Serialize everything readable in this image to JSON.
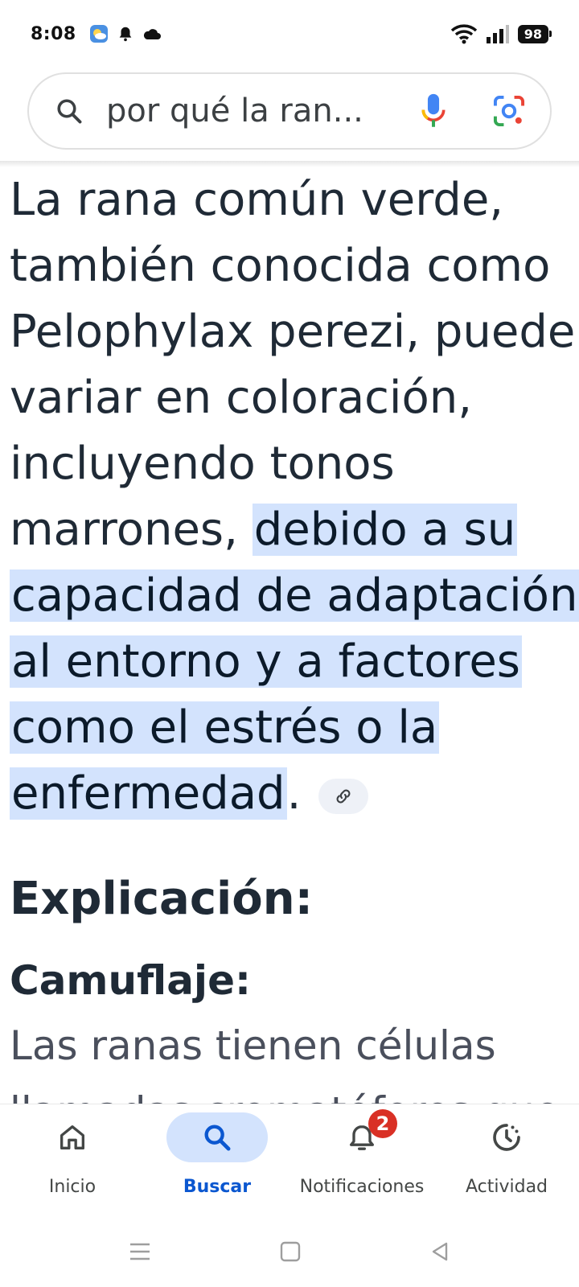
{
  "status_bar": {
    "time": "8:08",
    "battery": "98"
  },
  "search": {
    "query": "por qué la ran..."
  },
  "answer": {
    "line1": "La rana común verde,",
    "line2": "también conocida como",
    "line3": "Pelophylax perezi, puede",
    "line4": "variar en coloración,",
    "line5": "incluyendo tonos",
    "line6_plain": "marrones, ",
    "line6_hl": "debido a su",
    "line7_hl": "capacidad de adaptación",
    "line8_hl": "al entorno y a factores",
    "line9_hl": "como el estrés o la",
    "line10_hl": "enfermedad",
    "line10_end": "."
  },
  "explanation": {
    "title": "Explicación:",
    "subtitle": "Camuflaje:",
    "body_line1": "Las ranas tienen células",
    "body_line2": "llamadas cromatóforos que"
  },
  "bottom_nav": {
    "items": [
      {
        "label": "Inicio",
        "icon": "home-icon"
      },
      {
        "label": "Buscar",
        "icon": "search-icon"
      },
      {
        "label": "Notificaciones",
        "icon": "bell-icon",
        "badge": "2"
      },
      {
        "label": "Actividad",
        "icon": "activity-icon"
      }
    ]
  },
  "colors": {
    "highlight": "#d3e3fd",
    "active": "#0b57d0",
    "badge": "#d93025"
  }
}
